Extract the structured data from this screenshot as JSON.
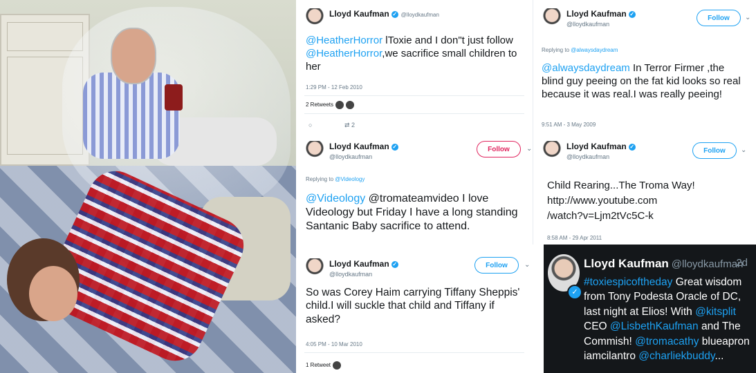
{
  "photo": {
    "description_icon": "photo"
  },
  "tweet1": {
    "name": "Lloyd Kaufman",
    "handle": "@lloydkaufman",
    "mention1": "@HeatherHorror",
    "text1": " lToxie and I don\"t just follow ",
    "mention2": "@HeatherHorror",
    "text2": ",we sacrifice small children to her",
    "timestamp": "1:29 PM - 12 Feb 2010",
    "retweets": "2 Retweets",
    "retweet_count": "2"
  },
  "tweet2": {
    "name": "Lloyd Kaufman",
    "handle": "@lloydkaufman",
    "follow": "Follow",
    "replying_prefix": "Replying to ",
    "replying_to": "@Videology",
    "mention1": "@Videology",
    "text": " @tromateamvideo I love Videology but Friday I have a long standing Santanic Baby sacrifice to attend."
  },
  "tweet3": {
    "name": "Lloyd Kaufman",
    "handle": "@lloydkaufman",
    "follow": "Follow",
    "text": "So was Corey Haim carrying Tiffany Sheppis' child.I will suckle that child and Tiffany if asked?",
    "timestamp": "4:05 PM - 10 Mar 2010",
    "retweets": "1 Retweet"
  },
  "tweet4": {
    "name": "Lloyd Kaufman",
    "handle": "@lloydkaufman",
    "follow": "Follow",
    "replying_prefix": "Replying to ",
    "replying_to": "@alwaysdaydream",
    "mention1": "@alwaysdaydream",
    "text": " In Terror Firmer ,the blind guy peeing on the fat kid looks so real because it was real.I was really peeing!",
    "timestamp": "9:51 AM - 3 May 2009"
  },
  "tweet5": {
    "name": "Lloyd Kaufman",
    "handle": "@lloydkaufman",
    "follow": "Follow",
    "line1": "Child Rearing...The Troma Way!",
    "line2": "http://www.youtube.com",
    "line3": "/watch?v=Ljm2tVc5C-k",
    "timestamp": "8:58 AM - 29 Apr 2011"
  },
  "tweet6": {
    "name": "Lloyd Kaufman",
    "handle": "@lloydkaufman",
    "age": "2d",
    "hashtag": "#toxiespicoftheday",
    "t1": " Great wisdom from Tony Podesta Oracle of DC, last night at Elios! With ",
    "m1": "@kitsplit",
    "t2": " CEO ",
    "m2": "@LisbethKaufman",
    "t3": " and The Commish! ",
    "m3": "@tromacathy",
    "t4": " blueapron iamcilantro ",
    "m4": "@charliekbuddy",
    "t5": "..."
  },
  "icons": {
    "verified": "verified-badge-icon",
    "chevron": "chevron-down-icon",
    "reply": "reply-icon",
    "retweet": "retweet-icon"
  },
  "colors": {
    "link": "#1da1f2",
    "follow_red": "#e0245e",
    "dark_bg": "#14171a"
  }
}
